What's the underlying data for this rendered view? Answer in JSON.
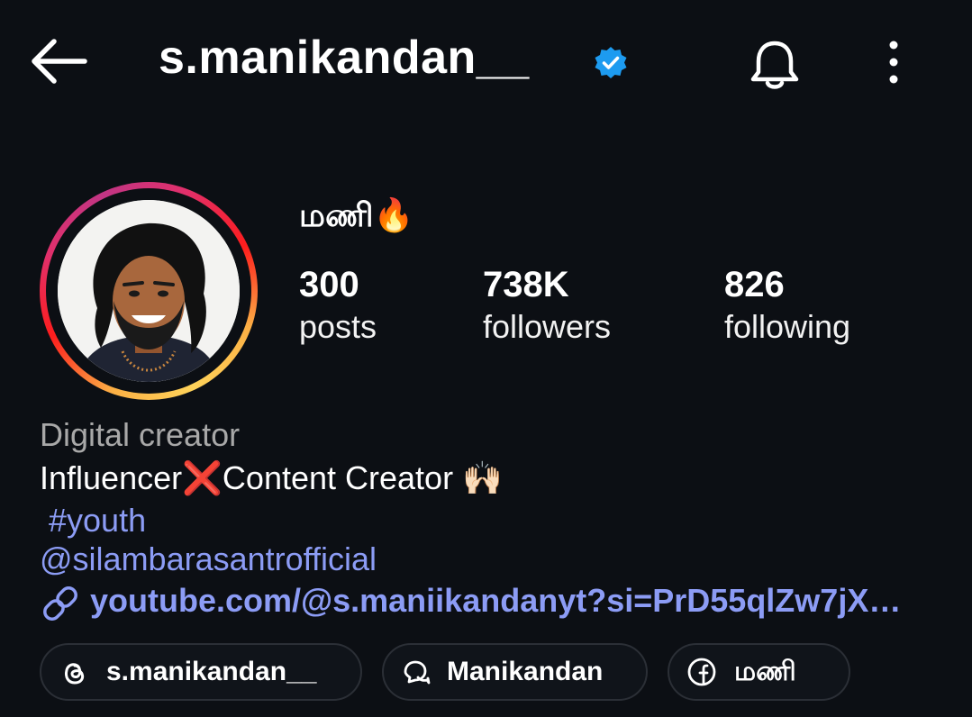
{
  "header": {
    "username": "s.manikandan__",
    "icons": {
      "back": "back-arrow-icon",
      "verified": "verified-badge-icon",
      "notifications": "bell-icon",
      "more": "more-vertical-icon"
    },
    "verified_color": "#1d9bf0"
  },
  "profile": {
    "display_name": "மணி🔥",
    "stats": [
      {
        "value": "300",
        "label": "posts"
      },
      {
        "value": "738K",
        "label": "followers"
      },
      {
        "value": "826",
        "label": "following"
      }
    ]
  },
  "bio": {
    "category": "Digital creator",
    "line1": "Influencer❌Content Creator 🙌🏻",
    "hashtag": "#youth",
    "mention": "@silambarasantrofficial",
    "link": "youtube.com/@s.maniikandanyt?si=PrD55qlZw7jX…",
    "link_color": "#8c9cf5"
  },
  "chips": [
    {
      "icon": "threads-icon",
      "label": "s.manikandan__"
    },
    {
      "icon": "chat-bubbles-icon",
      "label": "Manikandan"
    },
    {
      "icon": "facebook-icon",
      "label": "மணி"
    }
  ]
}
